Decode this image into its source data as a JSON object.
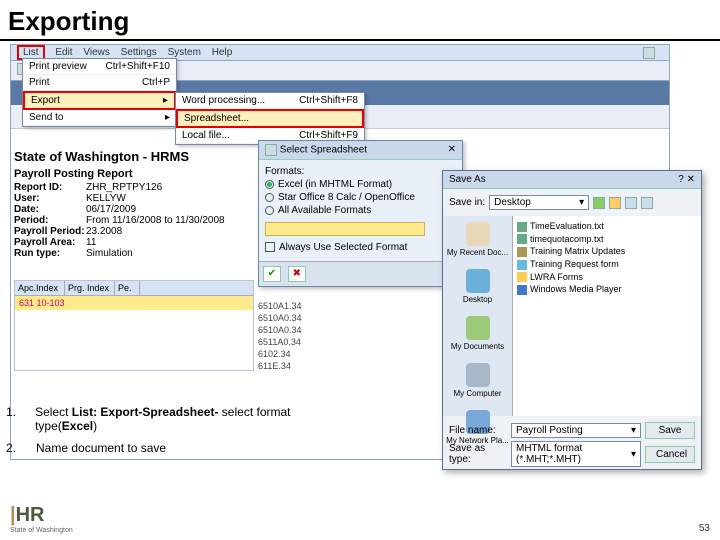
{
  "title": "Exporting",
  "menubar": {
    "items": [
      "List",
      "Edit",
      "Views",
      "Settings",
      "System",
      "Help"
    ]
  },
  "listMenu": [
    {
      "label": "Print preview",
      "shortcut": "Ctrl+Shift+F10"
    },
    {
      "label": "Print",
      "shortcut": "Ctrl+P"
    },
    {
      "label": "Export",
      "shortcut": "▸"
    },
    {
      "label": "Send to",
      "shortcut": "▸"
    }
  ],
  "exportSubmenu": [
    {
      "label": "Word processing...",
      "shortcut": "Ctrl+Shift+F8"
    },
    {
      "label": "Spreadsheet...",
      "shortcut": ""
    },
    {
      "label": "Local file...",
      "shortcut": "Ctrl+Shift+F9"
    }
  ],
  "report": {
    "title1": "State of Washington - HRMS",
    "title2": "Payroll Posting Report",
    "rows": [
      {
        "k": "Report ID:",
        "v": "ZHR_RPTPY126"
      },
      {
        "k": "User:",
        "v": "KELLYW"
      },
      {
        "k": "Date:",
        "v": "06/17/2009"
      },
      {
        "k": "Period:",
        "v": "From 11/16/2008 to 11/30/2008"
      },
      {
        "k": "Payroll Period:",
        "v": "23.2008"
      },
      {
        "k": "Payroll Area:",
        "v": "11"
      },
      {
        "k": "Run type:",
        "v": "Simulation"
      }
    ]
  },
  "table": {
    "headers": [
      "Apc.Index",
      "Prg. Index",
      "Pe."
    ],
    "yellowRow": "631    10-103"
  },
  "codes": [
    "6510A1.34",
    "6510A0.34",
    "6510A0.34",
    "6511A0.34",
    "6102.34",
    "611E.34"
  ],
  "selectDlg": {
    "title": "Select Spreadsheet",
    "formatsLabel": "Formats:",
    "opts": [
      {
        "label": "Excel (in MHTML Format)",
        "sel": true
      },
      {
        "label": "Star Office 8 Calc / OpenOffice",
        "sel": false
      },
      {
        "label": "All Available Formats",
        "sel": false
      }
    ],
    "fieldLabel": "  ",
    "always": "Always Use Selected Format",
    "ok": "✔",
    "cancel": "✖"
  },
  "saveAs": {
    "title": "Save As",
    "saveInLabel": "Save in:",
    "saveIn": "Desktop",
    "places": [
      "My Recent Doc...",
      "Desktop",
      "My Documents",
      "My Computer",
      "My Network Pla..."
    ],
    "files": [
      {
        "name": "TimeEvaluation.txt",
        "color": "#6a8"
      },
      {
        "name": "timequotacomp.txt",
        "color": "#6a8"
      },
      {
        "name": "Training Matrix Updates",
        "color": "#a95"
      },
      {
        "name": "Training Request form",
        "color": "#6bd"
      },
      {
        "name": "LWRA Forms",
        "color": "#fc5"
      },
      {
        "name": "Windows Media Player",
        "color": "#47c"
      }
    ],
    "fileNameLabel": "File name:",
    "fileName": "Payroll Posting",
    "saveTypeLabel": "Save as type:",
    "saveType": "MHTML format (*.MHT;*.MHT)",
    "saveBtn": "Save",
    "cancelBtn": "Cancel"
  },
  "instructions": [
    {
      "n": "1.",
      "html": "Select <b>List: Export-Spreadsheet-</b> select format type(<b>Excel</b>)"
    },
    {
      "n": "2.",
      "html": "Name document to save"
    }
  ],
  "footer": {
    "hr": "HR",
    "sow": "State of Washington",
    "page": "53"
  }
}
